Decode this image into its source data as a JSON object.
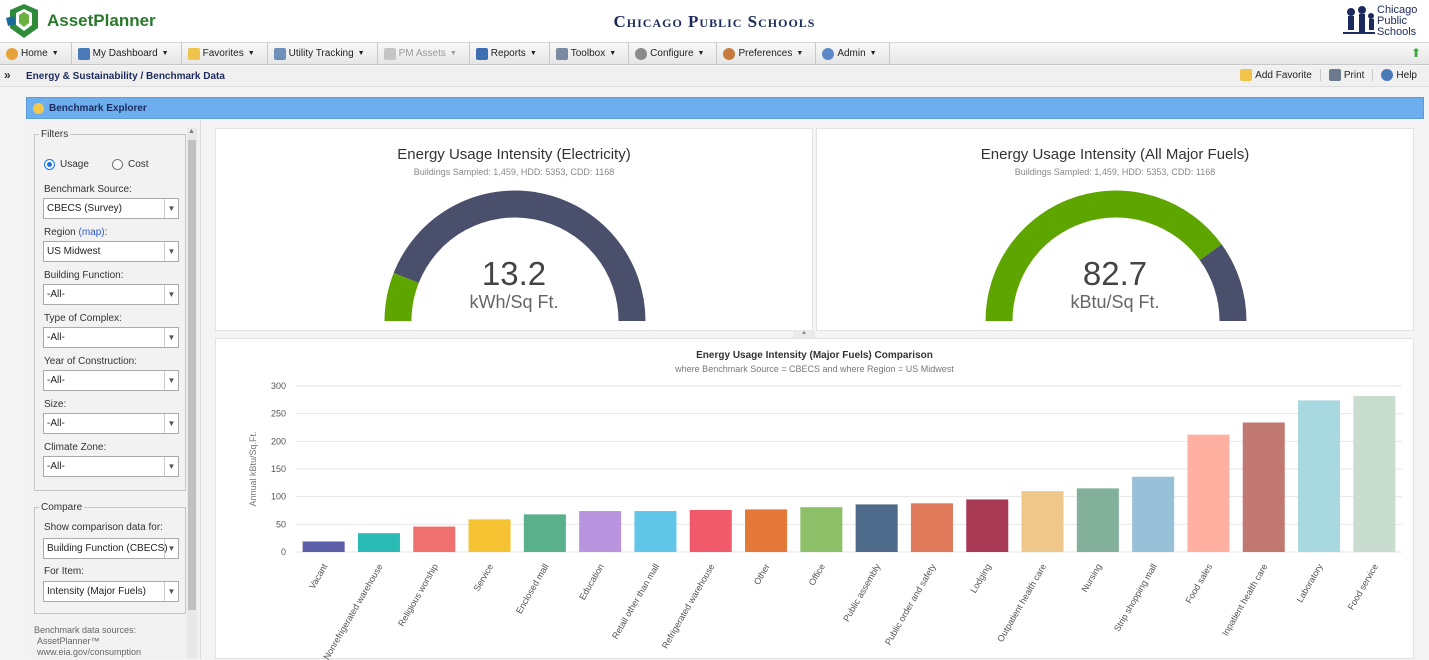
{
  "header": {
    "app_name": "AssetPlanner",
    "site_title": "Chicago Public Schools",
    "org_logo_text": [
      "Chicago",
      "Public",
      "Schools"
    ]
  },
  "menu": [
    {
      "label": "Home",
      "icon": "home-icon",
      "color": "#e7a23a",
      "disabled": false
    },
    {
      "label": "My Dashboard",
      "icon": "dashboard-icon",
      "color": "#4a79b8",
      "disabled": false
    },
    {
      "label": "Favorites",
      "icon": "favorites-folder-icon",
      "color": "#f0c34a",
      "disabled": false
    },
    {
      "label": "Utility Tracking",
      "icon": "utility-tracking-icon",
      "color": "#6d8fb8",
      "disabled": false
    },
    {
      "label": "PM Assets",
      "icon": "pm-assets-icon",
      "color": "#b5b5b5",
      "disabled": true
    },
    {
      "label": "Reports",
      "icon": "reports-icon",
      "color": "#3e6fb3",
      "disabled": false
    },
    {
      "label": "Toolbox",
      "icon": "toolbox-icon",
      "color": "#7a8aa0",
      "disabled": false
    },
    {
      "label": "Configure",
      "icon": "configure-gear-icon",
      "color": "#8a8a8a",
      "disabled": false
    },
    {
      "label": "Preferences",
      "icon": "preferences-user-icon",
      "color": "#c67a3b",
      "disabled": false
    },
    {
      "label": "Admin",
      "icon": "admin-icon",
      "color": "#5a88c8",
      "disabled": false
    }
  ],
  "breadcrumb": "Energy & Sustainability / Benchmark Data",
  "crumb_actions": {
    "add_favorite": "Add Favorite",
    "print": "Print",
    "help": "Help"
  },
  "panel": {
    "title": "Benchmark Explorer"
  },
  "filters": {
    "legend": "Filters",
    "mode_usage": "Usage",
    "mode_cost": "Cost",
    "selected_mode": "Usage",
    "benchmark_source_label": "Benchmark Source:",
    "benchmark_source": "CBECS (Survey)",
    "region_label": "Region",
    "region_link": "(map)",
    "region_colon": ":",
    "region": "US Midwest",
    "building_function_label": "Building Function:",
    "building_function": "-All-",
    "type_of_complex_label": "Type of Complex:",
    "type_of_complex": "-All-",
    "year_label": "Year of Construction:",
    "year": "-All-",
    "size_label": "Size:",
    "size": "-All-",
    "climate_label": "Climate Zone:",
    "climate": "-All-"
  },
  "compare": {
    "legend": "Compare",
    "show_label": "Show comparison data for:",
    "show_value": "Building Function (CBECS)",
    "item_label": "For Item:",
    "item_value": "Intensity (Major Fuels)"
  },
  "sources": {
    "label": "Benchmark data sources:",
    "line1": "AssetPlanner™",
    "line2": "www.eia.gov/consumption"
  },
  "gauges": [
    {
      "title": "Energy Usage Intensity (Electricity)",
      "subtitle": "Buildings Sampled: 1,459, HDD: 5353, CDD: 1168",
      "value": "13.2",
      "unit": "kWh/Sq Ft.",
      "fill_fraction": 0.12,
      "fill_color": "#5fa500",
      "rest_color": "#4a4f6b"
    },
    {
      "title": "Energy Usage Intensity (All Major Fuels)",
      "subtitle": "Buildings Sampled: 1,459, HDD: 5353, CDD: 1168",
      "value": "82.7",
      "unit": "kBtu/Sq Ft.",
      "fill_fraction": 0.8,
      "fill_color": "#5fa500",
      "rest_color": "#4a4f6b"
    }
  ],
  "chart_data": {
    "type": "bar",
    "title": "Energy Usage Intensity (Major Fuels) Comparison",
    "subtitle": "where Benchmark Source = CBECS and where Region = US Midwest",
    "xlabel": "",
    "ylabel": "Annual kBtu/Sq.Ft.",
    "ylim": [
      0,
      300
    ],
    "yticks": [
      0,
      50,
      100,
      150,
      200,
      250,
      300
    ],
    "grid": true,
    "categories": [
      "Vacant",
      "Nonrefrigerated warehouse",
      "Religious worship",
      "Service",
      "Enclosed mall",
      "Education",
      "Retail other than mall",
      "Refrigerated warehouse",
      "Other",
      "Office",
      "Public assembly",
      "Public order and safety",
      "Lodging",
      "Outpatient health care",
      "Nursing",
      "Strip shopping mall",
      "Food sales",
      "Inpatient health care",
      "Laboratory",
      "Food service"
    ],
    "values": [
      19,
      34,
      46,
      59,
      68,
      74,
      74,
      76,
      77,
      81,
      86,
      88,
      95,
      110,
      115,
      136,
      212,
      234,
      274,
      282
    ],
    "colors": [
      "#5b5ea6",
      "#2bbbb6",
      "#f07070",
      "#f5c232",
      "#5ab08a",
      "#b995e0",
      "#62c6e8",
      "#f05a6a",
      "#e37838",
      "#8ec06a",
      "#4e6a8a",
      "#e07a5a",
      "#a83a56",
      "#f0c78a",
      "#82b09a",
      "#98c0d8",
      "#ffb0a0",
      "#c07870",
      "#a8d8e0",
      "#c8dcd0"
    ]
  }
}
